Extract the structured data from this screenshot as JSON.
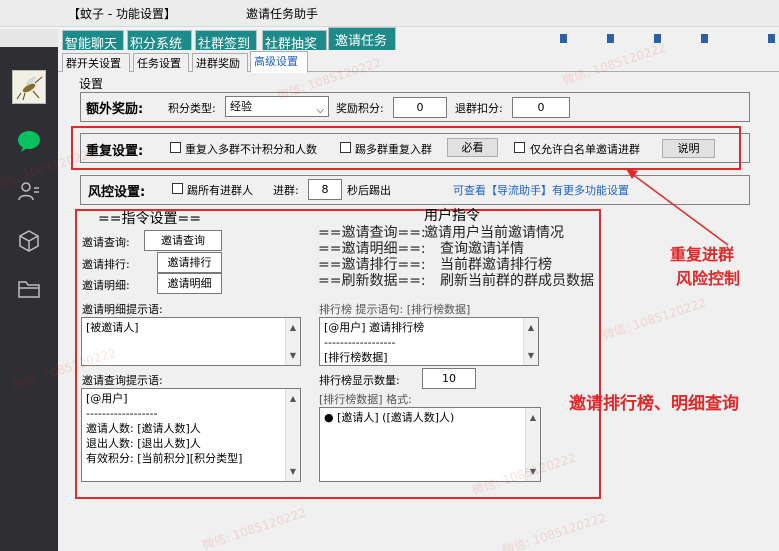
{
  "window": {
    "app_title": "【蚊子 - 功能设置】",
    "dialog_title": "邀请任务助手"
  },
  "top_tabs": [
    {
      "label": "智能聊天"
    },
    {
      "label": "积分系统"
    },
    {
      "label": "社群签到"
    },
    {
      "label": "社群抽奖"
    },
    {
      "label": "邀请任务"
    }
  ],
  "sub_tabs": [
    {
      "label": "群开关设置"
    },
    {
      "label": "任务设置"
    },
    {
      "label": "进群奖励"
    },
    {
      "label": "高级设置"
    }
  ],
  "settings_label": "设置",
  "extra_reward": {
    "title": "额外奖励:",
    "points_type_label": "积分类型:",
    "points_type_value": "经验",
    "reward_points_label": "奖励积分:",
    "reward_points_value": "0",
    "leave_deduct_label": "退群扣分:",
    "leave_deduct_value": "0"
  },
  "repeat": {
    "title": "重复设置:",
    "rejoin_label": "重复入多群不计积分和人数",
    "kick_label": "踢多群重复入群",
    "must_read_button": "必看",
    "whitelist_label": "仅允许白名单邀请进群",
    "explain_button": "说明"
  },
  "risk": {
    "title": "风控设置:",
    "kick_all_label": "踢所有进群人",
    "join_label": "进群:",
    "join_value": "8",
    "after_label": "秒后踢出",
    "link_text": "可查看【导流助手】有更多功能设置"
  },
  "commands": {
    "heading": "==指令设置==",
    "user_cmd_heading": "用户指令",
    "rows": [
      {
        "label": "邀请查询:",
        "value": "邀请查询"
      },
      {
        "label": "邀请排行:",
        "value": "邀请排行"
      },
      {
        "label": "邀请明细:",
        "value": "邀请明细"
      }
    ],
    "descriptions": [
      {
        "cmd": "==邀请查询==:",
        "desc": "邀请用户当前邀请情况"
      },
      {
        "cmd": "==邀请明细==:",
        "desc": "查询邀请详情"
      },
      {
        "cmd": "==邀请排行==:",
        "desc": "当前群邀请排行榜"
      },
      {
        "cmd": "==刷新数据==:",
        "desc": "刷新当前群的群成员数据"
      }
    ]
  },
  "detail_prompt": {
    "label": "邀请明细提示语:",
    "text": "[被邀请人]"
  },
  "rank_prompt": {
    "label": "排行榜 提示语句: [排行榜数据]",
    "lines": [
      "[@用户] 邀请排行榜",
      "------------------",
      "[排行榜数据]"
    ]
  },
  "query_prompt": {
    "label": "邀请查询提示语:",
    "lines": [
      "[@用户]",
      "------------------",
      "邀请人数: [邀请人数]人",
      "退出人数: [退出人数]人",
      "有效积分: [当前积分][积分类型]"
    ]
  },
  "rank_count": {
    "label": "排行榜显示数量:",
    "value": "10"
  },
  "rank_format": {
    "label": "[排行榜数据] 格式:",
    "text": "● [邀请人] ([邀请人数]人)"
  },
  "annotations": {
    "repeat_risk": [
      "重复进群",
      "风险控制"
    ],
    "rank_detail": "邀请排行榜、明细查询"
  },
  "watermark": "微信: 1085120222",
  "colors": {
    "tab_teal": "#1e8b8b",
    "annotation_red": "#e2282a",
    "link_blue": "#1d5fd6",
    "sidebar_dark": "#2f2e33",
    "chat_green": "#07c160"
  }
}
